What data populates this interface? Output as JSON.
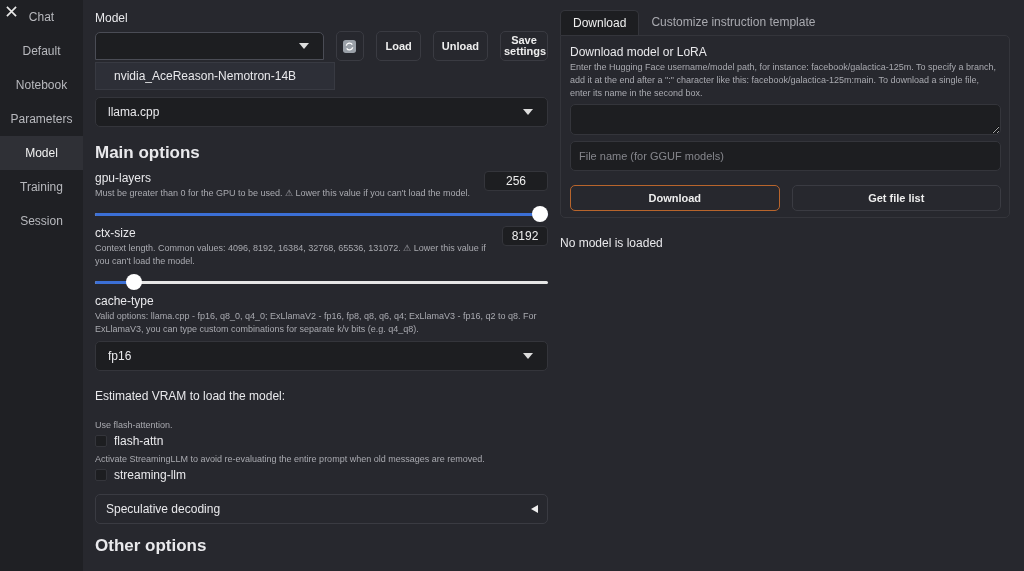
{
  "sidebar": {
    "items": [
      {
        "label": "Chat",
        "selected": false
      },
      {
        "label": "Default",
        "selected": false
      },
      {
        "label": "Notebook",
        "selected": false
      },
      {
        "label": "Parameters",
        "selected": false
      },
      {
        "label": "Model",
        "selected": true
      },
      {
        "label": "Training",
        "selected": false
      },
      {
        "label": "Session",
        "selected": false
      }
    ]
  },
  "model": {
    "label": "Model",
    "expanded": true,
    "options": [
      "nvidia_AceReason-Nemotron-14B"
    ]
  },
  "model_buttons": [
    {
      "kind": "icon"
    },
    {
      "kind": "text",
      "label": "Load"
    },
    {
      "kind": "text",
      "label": "Unload"
    },
    {
      "kind": "text",
      "label": "Save settings"
    }
  ],
  "loader": {
    "value": "llama.cpp"
  },
  "main_options": {
    "title": "Main options",
    "params": [
      {
        "kind": "slider",
        "name": "gpu-layers",
        "description": "Must be greater than 0 for the GPU to be used. ⚠ Lower this value if you can't load the model.",
        "value": "256",
        "level": 1.0
      },
      {
        "kind": "slider",
        "name": "ctx-size",
        "description": "Context length. Common values: 4096, 8192, 16384, 32768, 65536, 131072. ⚠ Lower this value if you can't load the model.",
        "value": "8192",
        "level": 0.07
      },
      {
        "kind": "select",
        "name": "cache-type",
        "description": "Valid options: llama.cpp - fp16, q8_0, q4_0; ExLlamaV2 - fp16, fp8, q8, q6, q4; ExLlamaV3 - fp16, q2 to q8. For ExLlamaV3, you can type custom combinations for separate k/v bits (e.g. q4_q8).",
        "value": "fp16"
      }
    ]
  },
  "vram_label": "Estimated VRAM to load the model:",
  "checks": [
    {
      "description": "Use flash-attention.",
      "label": "flash-attn",
      "checked": false
    },
    {
      "description": "Activate StreamingLLM to avoid re-evaluating the entire prompt when old messages are removed.",
      "label": "streaming-llm",
      "checked": false
    }
  ],
  "accordion": {
    "title": "Speculative decoding",
    "expanded": false
  },
  "other_options_title": "Other options",
  "tabs": [
    {
      "label": "Download",
      "selected": true
    },
    {
      "label": "Customize instruction template",
      "selected": false
    }
  ],
  "download": {
    "title": "Download model or LoRA",
    "description": "Enter the Hugging Face username/model path, for instance: facebook/galactica-125m. To specify a branch, add it at the end after a \":\" character like this: facebook/galactica-125m:main. To download a single file, enter its name in the second box.",
    "file_field": {
      "placeholder": "File name (for GGUF models)"
    },
    "buttons": [
      {
        "label": "Download",
        "primary": true
      },
      {
        "label": "Get file list",
        "primary": false
      }
    ]
  },
  "status": "No model is loaded"
}
